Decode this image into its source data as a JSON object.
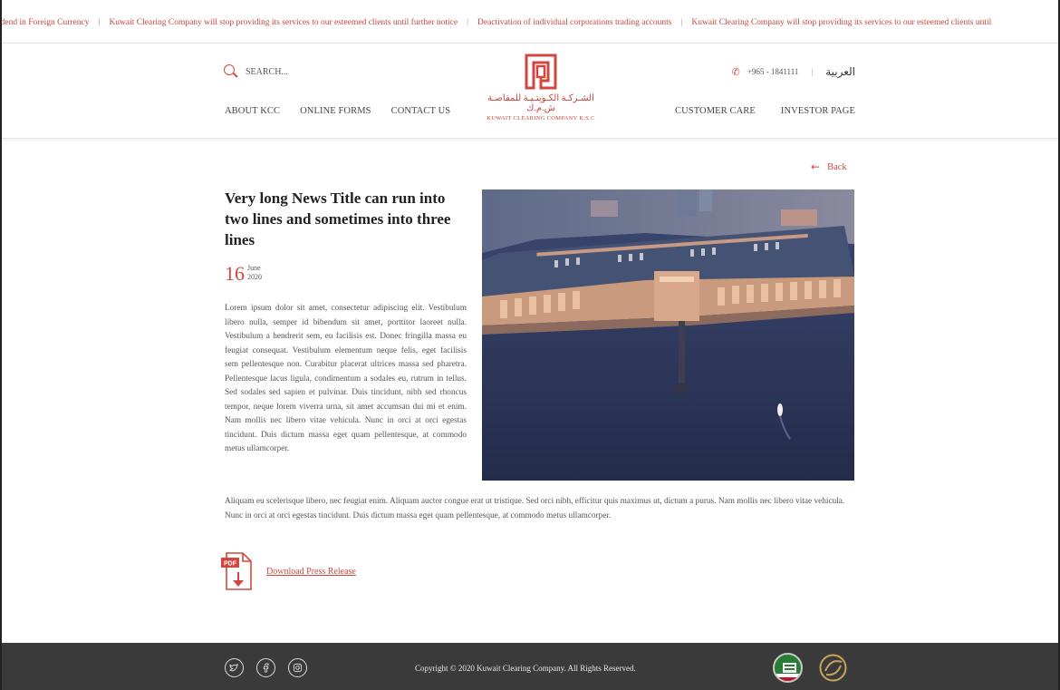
{
  "ticker": {
    "items": [
      "idend in Foreign Currency",
      "Kuwait Clearing Company will stop providing its services to our esteemed clients until further notice",
      "Deactivation of individual corporations trading accounts",
      "Kuwait Clearing Company will stop providing its services to our esteemed clients until"
    ],
    "separator": "|"
  },
  "header": {
    "search_placeholder": "SEARCH...",
    "phone": "+965 - 1841111",
    "divider": "|",
    "language": "العربية",
    "logo_arabic": "الشـركـة الكـويتـيـة للمقاصـة ش.م.ك",
    "logo_english": "KUWAIT CLEARING COMPANY K.S.C",
    "nav_left": [
      "ABOUT KCC",
      "ONLINE FORMS",
      "CONTACT US"
    ],
    "nav_right": [
      "CUSTOMER CARE",
      "INVESTOR PAGE"
    ]
  },
  "article": {
    "back_label": "Back",
    "title": "Very long News Title can run into two lines and sometimes into three lines",
    "date_day": "16",
    "date_month": "June",
    "date_year": "2020",
    "paragraph_1": "Lorem ipsum dolor sit amet, consectetur adipiscing elit. Vestibulum libero nulla, semper id bibendum sit amet, porttitor laoreet nulla. Vestibulum a hendrerit sem, eu facilisis est. Donec fringilla massa eu feugiat consequat. Vestibulum elementum neque felis, eget facilisis sem pellentesque non. Curabitur placerat ultrices massa sed pharetra. Pellentesque lacus ligula, condimentum a sodales eu, rutrum in tellus. Sed sodales sed sapien et pulvinar. Duis tincidunt, nibh sed rhoncus tempor, neque lorem viverra urna, sit amet accumsan dui mi et enim. Nam mollis nec libero vitae vehicula. Nunc in orci at orci egestas tincidunt. Duis dictum massa eget quam pellentesque, at commodo metus ullamcorper.",
    "paragraph_2": "Aliquam eu scelerisque libero, nec feugiat enim. Aliquam auctor congue erat ut tristique. Sed orci nibh, efficitur quis maximus ut, dictum a purus. Nam mollis nec libero vitae vehicula. Nunc in orci at orci egestas tincidunt. Duis dictum massa eget quam pellentesque, at commodo metus ullamcorper.",
    "download_label": "Download Press Release",
    "pdf_badge": "PDF"
  },
  "footer": {
    "copyright": "Copyright © 2020 Kuwait Clearing Company. All Rights Reserved.",
    "social_icons": [
      "twitter-icon",
      "facebook-icon",
      "instagram-icon"
    ]
  },
  "colors": {
    "accent": "#d2473d",
    "footer_bg": "#3a3a3a",
    "text": "#555555"
  }
}
